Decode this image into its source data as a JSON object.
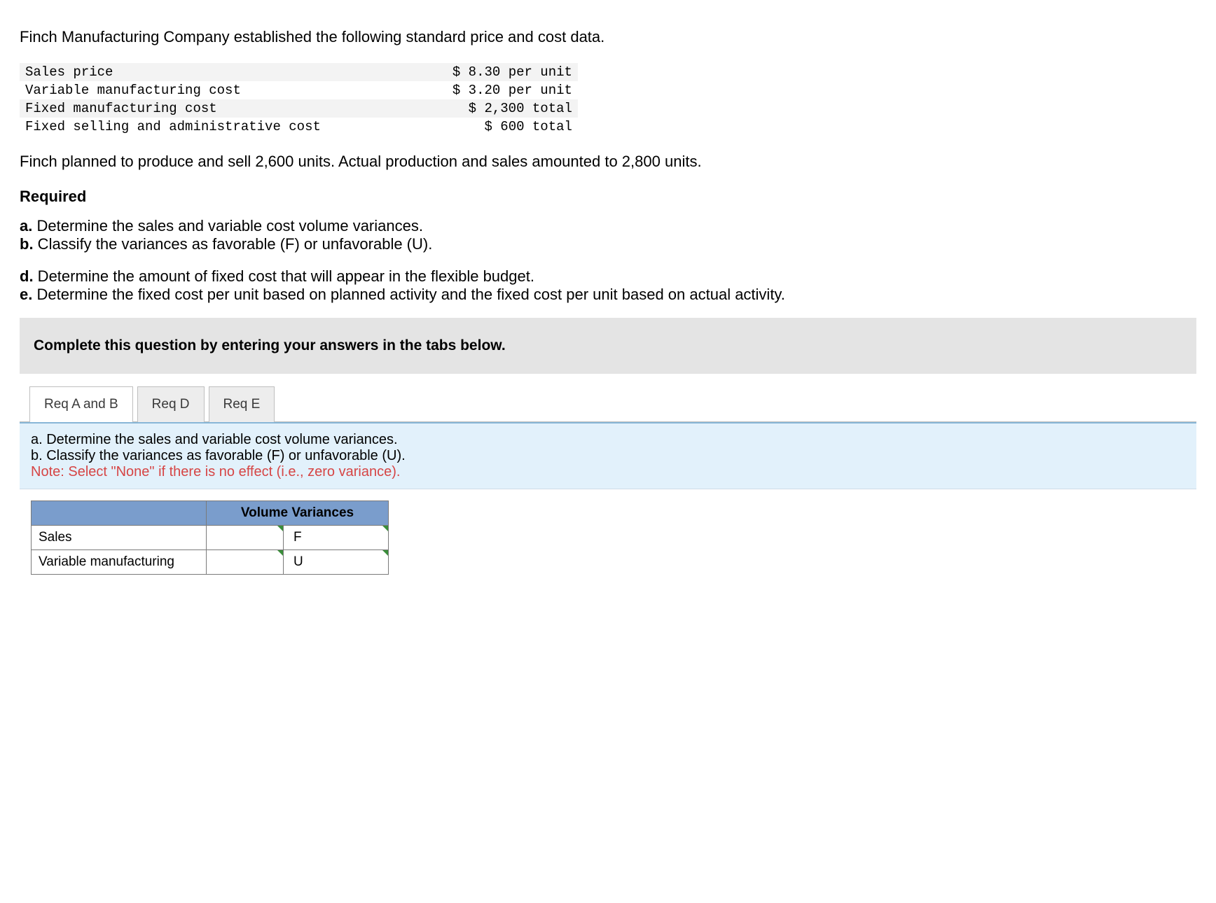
{
  "intro": "Finch Manufacturing Company established the following standard price and cost data.",
  "data_rows": [
    {
      "label": "Sales price",
      "value": "$ 8.30 per unit"
    },
    {
      "label": "Variable manufacturing cost",
      "value": "$ 3.20 per unit"
    },
    {
      "label": "Fixed manufacturing cost",
      "value": "$ 2,300 total"
    },
    {
      "label": "Fixed selling and administrative cost",
      "value": "$ 600 total"
    }
  ],
  "narrative": "Finch planned to produce and sell 2,600 units. Actual production and sales amounted to 2,800 units.",
  "required_heading": "Required",
  "requirements": {
    "a_prefix": "a.",
    "a_text": " Determine the sales and variable cost volume variances.",
    "b_prefix": "b.",
    "b_text": " Classify the variances as favorable (F) or unfavorable (U).",
    "d_prefix": "d.",
    "d_text": " Determine the amount of fixed cost that will appear in the flexible budget.",
    "e_prefix": "e.",
    "e_text": " Determine the fixed cost per unit based on planned activity and the fixed cost per unit based on actual activity."
  },
  "instruction_bar": "Complete this question by entering your answers in the tabs below.",
  "tabs": {
    "tab_ab": "Req A and B",
    "tab_d": "Req D",
    "tab_e": "Req E"
  },
  "tab_panel": {
    "line_a": "a. Determine the sales and variable cost volume variances.",
    "line_b": "b. Classify the variances as favorable (F) or unfavorable (U).",
    "note": "Note: Select \"None\" if there is no effect (i.e., zero variance)."
  },
  "answer_table": {
    "header": "Volume Variances",
    "rows": [
      {
        "label": "Sales",
        "amount": "",
        "classification": "F"
      },
      {
        "label": "Variable manufacturing",
        "amount": "",
        "classification": "U"
      }
    ]
  }
}
